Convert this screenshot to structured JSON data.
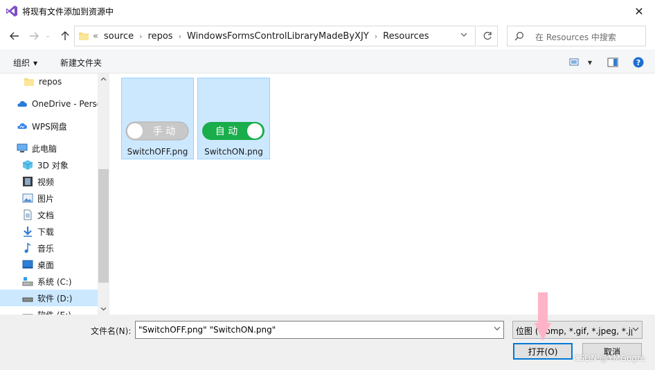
{
  "window": {
    "title": "将现有文件添加到资源中"
  },
  "address": {
    "lead": "«",
    "crumbs": [
      "source",
      "repos",
      "WindowsFormsControlLibraryMadeByXJY",
      "Resources"
    ]
  },
  "search": {
    "placeholder": "在 Resources 中搜索"
  },
  "toolbar": {
    "organize": "组织",
    "new_folder": "新建文件夹"
  },
  "nav": {
    "items": [
      {
        "label": "repos",
        "icon": "folder-icon"
      },
      {
        "label": "OneDrive - Personal",
        "icon": "onedrive-icon"
      },
      {
        "label": "WPS网盘",
        "icon": "wps-cloud-icon"
      },
      {
        "label": "此电脑",
        "icon": "computer-icon"
      },
      {
        "label": "3D 对象",
        "icon": "3d-objects-icon"
      },
      {
        "label": "视频",
        "icon": "video-icon"
      },
      {
        "label": "图片",
        "icon": "pictures-icon"
      },
      {
        "label": "文档",
        "icon": "documents-icon"
      },
      {
        "label": "下载",
        "icon": "download-icon"
      },
      {
        "label": "音乐",
        "icon": "music-icon"
      },
      {
        "label": "桌面",
        "icon": "desktop-icon"
      },
      {
        "label": "系统 (C:)",
        "icon": "drive-c-icon"
      },
      {
        "label": "软件 (D:)",
        "icon": "drive-d-icon"
      },
      {
        "label": "软件 (E:)",
        "icon": "drive-e-icon"
      }
    ]
  },
  "files": [
    {
      "name": "SwitchOFF.png",
      "thumb_text": "手 动",
      "state": "off"
    },
    {
      "name": "SwitchON.png",
      "thumb_text": "自 动",
      "state": "on"
    }
  ],
  "footer": {
    "filename_label": "文件名(N):",
    "filename_value": "\"SwitchOFF.png\" \"SwitchON.png\"",
    "filter_value": "位图 (*.bmp, *.gif, *.jpeg, *.jp",
    "open_label": "打开(O)",
    "cancel_label": "取消"
  },
  "watermark": "CSDN @YMGogre",
  "colors": {
    "selection": "#cce8ff",
    "switch_on": "#1aad4b",
    "switch_off": "#c8c8c8",
    "accent": "#0078d7",
    "pointer": "#ffb3c7"
  }
}
